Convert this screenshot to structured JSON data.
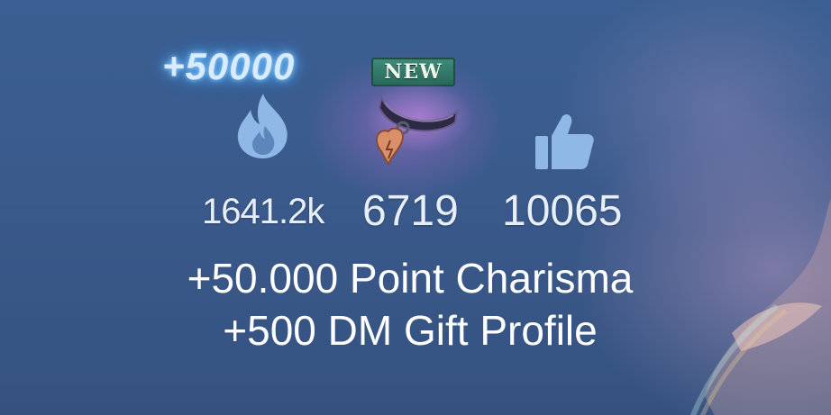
{
  "reward_popup": "+50000",
  "new_badge": "NEW",
  "stats": {
    "charisma": "1641.2k",
    "gifts": "6719",
    "likes": "10065"
  },
  "caption": {
    "line1": "+50.000 Point Charisma",
    "line2": "+500 DM Gift Profile"
  },
  "icons": {
    "charisma": "flame-icon",
    "gift": "heart-lock-collar-icon",
    "likes": "thumbs-up-icon"
  },
  "colors": {
    "background": "#3a5a8c",
    "icon_blue": "#8fb8e6",
    "glow": "#5fb6ff",
    "badge_green": "#2f7565",
    "lock_copper": "#d88f6a"
  }
}
